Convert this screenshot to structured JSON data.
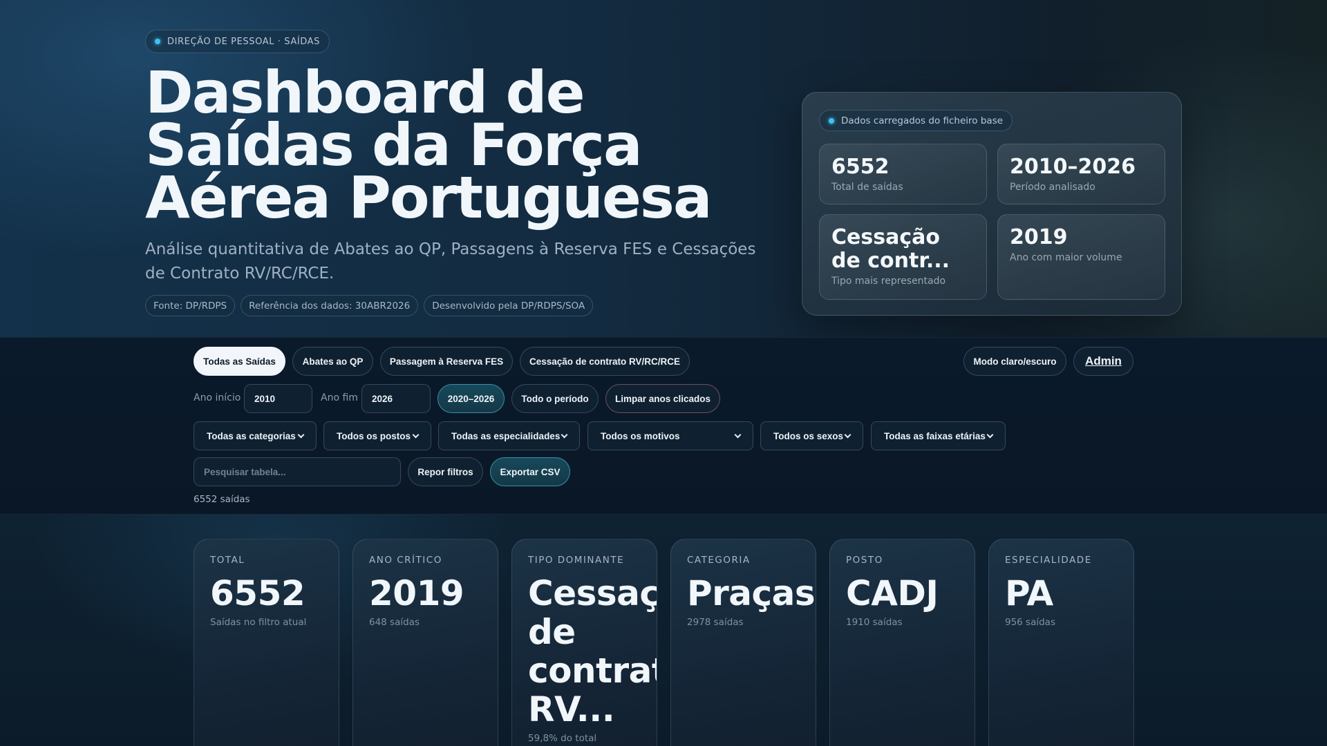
{
  "hero": {
    "eyebrow": "DIREÇÃO DE PESSOAL · SAÍDAS",
    "title": "Dashboard de Saídas da Força Aérea Portuguesa",
    "subtitle": "Análise quantitativa de Abates ao QP, Passagens à Reserva FES e Cessações de Contrato RV/RC/RCE.",
    "meta": [
      "Fonte: DP/RDPS",
      "Referência dos dados: 30ABR2026",
      "Desenvolvido pela DP/RDPS/SOA"
    ]
  },
  "summary": {
    "badge": "Dados carregados do ficheiro base",
    "stats": [
      {
        "value": "6552",
        "label": "Total de saídas"
      },
      {
        "value": "2010–2026",
        "label": "Período analisado"
      },
      {
        "value": "Cessação de contr...",
        "label": "Tipo mais representado"
      },
      {
        "value": "2019",
        "label": "Ano com maior volume"
      }
    ]
  },
  "controls": {
    "tabs": [
      "Todas as Saídas",
      "Abates ao QP",
      "Passagem à Reserva FES",
      "Cessação de contrato RV/RC/RCE"
    ],
    "theme_toggle": "Modo claro/escuro",
    "admin": "Admin",
    "year_start_label": "Ano início",
    "year_start_value": "2010",
    "year_end_label": "Ano fim",
    "year_end_value": "2026",
    "range_button": "2020–2026",
    "all_period_button": "Todo o período",
    "clear_years_button": "Limpar anos clicados",
    "selects": [
      "Todas as categorias",
      "Todos os postos",
      "Todas as especialidades",
      "Todos os motivos",
      "Todos os sexos",
      "Todas as faixas etárias"
    ],
    "search_placeholder": "Pesquisar tabela...",
    "reset_button": "Repor filtros",
    "export_button": "Exportar CSV",
    "count": "6552 saídas"
  },
  "kpis": [
    {
      "label": "TOTAL",
      "value": "6552",
      "sub": "Saídas no filtro atual"
    },
    {
      "label": "ANO CRÍTICO",
      "value": "2019",
      "sub": "648 saídas"
    },
    {
      "label": "TIPO DOMINANTE",
      "value": "Cessação de contrato RV...",
      "sub": "59,8% do total"
    },
    {
      "label": "CATEGORIA",
      "value": "Praças",
      "sub": "2978 saídas"
    },
    {
      "label": "POSTO",
      "value": "CADJ",
      "sub": "1910 saídas"
    },
    {
      "label": "ESPECIALIDADE",
      "value": "PA",
      "sub": "956 saídas"
    }
  ],
  "colors": {
    "accent": "#3ec1f0",
    "background": "#0b1a2a",
    "active_tab": "#f2f6fa"
  }
}
